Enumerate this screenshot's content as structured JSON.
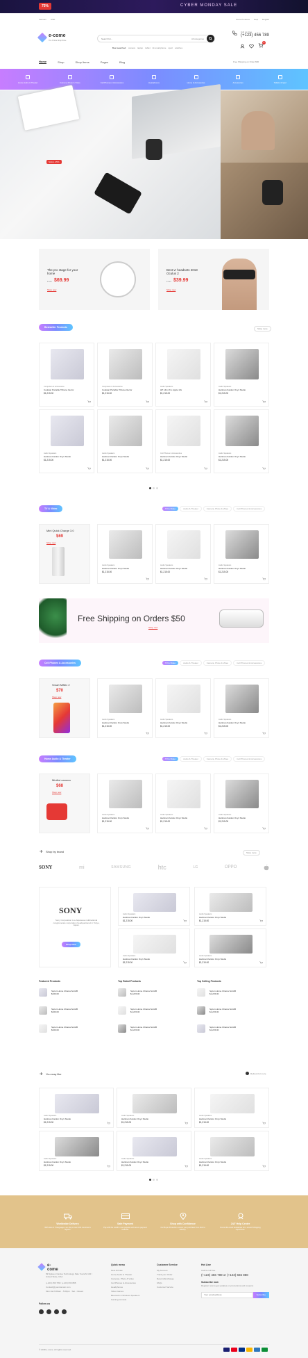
{
  "promo": {
    "badge": "75%",
    "text": "CYBER MONDAY SALE"
  },
  "topbar": {
    "left1": "Vietnam",
    "left2": "USD",
    "right1": "Store Products",
    "right2": "Help",
    "right3": "English"
  },
  "header": {
    "logo": "e-come",
    "tagline": "The Online Shop Store",
    "search_placeholder": "Search for...",
    "category": "All categories",
    "tags": [
      "Best searched:",
      "camera",
      "laptop",
      "tablet",
      "4k smartphone",
      "sport",
      "watches"
    ],
    "call_label": "Call us Free",
    "phone": "(+123) 456 789",
    "cart_count": "0"
  },
  "nav": {
    "items": [
      "Home",
      "Shop",
      "Shop Items",
      "Pages",
      "Blog"
    ],
    "shipping": "Free Shipping on Order $50"
  },
  "categories": [
    "Home Audio & Theater",
    "Camera, Photo & Video",
    "Cell Phones & Accessories",
    "Headphones",
    "Home & Accessories",
    "Accessories",
    "Tablets & Ipad"
  ],
  "hero": {
    "badge": "SALE -25%"
  },
  "promo_cards": [
    {
      "title": "The pro stage for your home",
      "price_label": "From",
      "price": "$69.99",
      "btn": "Shop now"
    },
    {
      "title": "Best vr headsets 2018 Oculus 2",
      "price_label": "From",
      "price": "$39.99",
      "btn": "Shop now"
    }
  ],
  "bestseller": {
    "tab": "Bestseller Products",
    "dropdown": "Shop more",
    "products": [
      {
        "cat": "Computers & Accessories",
        "name": "Coolstar Portable Tribuna Vector",
        "price": "$1,215.00"
      },
      {
        "cat": "Computers & Accessories",
        "name": "Coolstar Portable Tribuna Vector",
        "price": "$1,215.00"
      },
      {
        "cat": "Audio Speakers",
        "name": "HP 14in 16 x Apple 13x",
        "price": "$1,215.00"
      },
      {
        "cat": "Audio Speakers",
        "name": "Hartman Kardon Onyx Studio",
        "price": "$1,215.00"
      },
      {
        "cat": "Audio Speakers",
        "name": "Hartman Kardon Onyx Studio",
        "price": "$1,215.00"
      },
      {
        "cat": "Audio Speakers",
        "name": "Hartman Kardon Onyx Studio",
        "price": "$1,215.00"
      },
      {
        "cat": "Cell Phones & Accessories",
        "name": "Hartman Kardon Onyx Studio",
        "price": "$1,215.00"
      },
      {
        "cat": "Audio Speakers",
        "name": "Hartman Kardon Onyx Studio",
        "price": "$1,215.00"
      }
    ]
  },
  "section_tv": {
    "tab": "TV & Video",
    "filters": [
      "TV & Video",
      "Audio & Theater",
      "Camera, Photo & Video",
      "Cell Phones & Accessories"
    ],
    "feature": {
      "title": "Mini Quick Charge 3.0",
      "price": "$69",
      "btn": "Shop now"
    },
    "products": [
      {
        "cat": "Audio Speakers",
        "name": "Hartman Kardon Onyx Studio",
        "price": "$1,215.00"
      },
      {
        "cat": "Audio Speakers",
        "name": "Hartman Kardon Onyx Studio",
        "price": "$1,215.00"
      },
      {
        "cat": "Audio Speakers",
        "name": "Hartman Kardon Onyx Studio",
        "price": "$1,215.00"
      }
    ]
  },
  "banner": {
    "title": "Free Shipping on Orders $50",
    "btn": "Shop now"
  },
  "section_cell": {
    "tab": "Cell Phones & Accessories",
    "filters": [
      "TV & Video",
      "Audio & Theater",
      "Camera, Photo & Video",
      "Cell Phones & Accessories"
    ],
    "feature": {
      "title": "Smart MiMix 2",
      "price": "$70",
      "btn": "Shop now"
    },
    "products": [
      {
        "cat": "Audio Speakers",
        "name": "Hartman Kardon Onyx Studio",
        "price": "$1,215.00"
      },
      {
        "cat": "Audio Speakers",
        "name": "Hartman Kardon Onyx Studio",
        "price": "$1,215.00"
      },
      {
        "cat": "Audio Speakers",
        "name": "Hartman Kardon Onyx Studio",
        "price": "$1,215.00"
      }
    ]
  },
  "section_home": {
    "tab": "Home Audio & Theater",
    "filters": [
      "TV & Video",
      "Audio & Theater",
      "Camera, Photo & Video",
      "Cell Phones & Accessories"
    ],
    "feature": {
      "title": "Minilist camera",
      "price": "$68",
      "btn": "Shop now"
    },
    "products": [
      {
        "cat": "Audio Speakers",
        "name": "Hartman Kardon Onyx Studio",
        "price": "$1,215.00"
      },
      {
        "cat": "Audio Speakers",
        "name": "Hartman Kardon Onyx Studio",
        "price": "$1,215.00"
      },
      {
        "cat": "Audio Speakers",
        "name": "Hartman Kardon Onyx Studio",
        "price": "$1,215.00"
      }
    ]
  },
  "brands": {
    "title": "Shop by brand",
    "dropdown": "Shop more",
    "list": [
      "SONY",
      "mi",
      "SAMSUNG",
      "htc",
      "LG",
      "OPPO",
      ""
    ],
    "feature": {
      "logo": "SONY",
      "text": "Sony Corporation is a Japanese multinational conglomerate corporation headquartered in Tokyo, Japan.",
      "btn": "Shop Now"
    },
    "products": [
      {
        "cat": "Audio Speakers",
        "name": "Hartman Kardon Onyx Studio",
        "price": "$1,215.00"
      },
      {
        "cat": "Audio Speakers",
        "name": "Hartman Kardon Onyx Studio",
        "price": "$1,215.00"
      },
      {
        "cat": "Audio Speakers",
        "name": "Hartman Kardon Onyx Studio",
        "price": "$1,215.00"
      },
      {
        "cat": "Audio Speakers",
        "name": "Hartman Kardon Onyx Studio",
        "price": "$1,215.00"
      }
    ]
  },
  "lists": [
    {
      "title": "Featured Products",
      "items": [
        {
          "name": "Spcon Home Ulrama SmtAB",
          "price": "$160.00"
        },
        {
          "name": "Spcon Home Ulrama SmtAB",
          "price": "$160.00"
        },
        {
          "name": "Spcon Home Ulrama SmtAB",
          "price": "$160.00"
        }
      ]
    },
    {
      "title": "Top Rated Products",
      "items": [
        {
          "name": "Spcon Home Ulrama SmtAB",
          "price": "$1,215.00"
        },
        {
          "name": "Spcon Home Ulrama SmtAB",
          "price": "$1,215.00"
        },
        {
          "name": "Spcon Home Ulrama SmtAB",
          "price": "$1,215.00"
        }
      ]
    },
    {
      "title": "Top Selling Products",
      "items": [
        {
          "name": "Spcon Home Ulrama SmtAB",
          "price": "$1,215.00"
        },
        {
          "name": "Spcon Home Ulrama SmtAB",
          "price": "$1,215.00"
        },
        {
          "name": "Spcon Home Ulrama SmtAB",
          "price": "$1,215.00"
        }
      ]
    }
  ],
  "youmay": {
    "title": "You may like",
    "refresh": "Refresh for more",
    "products": [
      {
        "cat": "Audio Speakers",
        "name": "Hartman Kardon Onyx Studio",
        "price": "$1,215.00"
      },
      {
        "cat": "Audio Speakers",
        "name": "Hartman Kardon Onyx Studio",
        "price": "$1,215.00"
      },
      {
        "cat": "Audio Speakers",
        "name": "Hartman Kardon Onyx Studio",
        "price": "$1,215.00"
      },
      {
        "cat": "Audio Speakers",
        "name": "Hartman Kardon Onyx Studio",
        "price": "$1,215.00"
      },
      {
        "cat": "Audio Speakers",
        "name": "Hartman Kardon Onyx Studio",
        "price": "$1,215.00"
      },
      {
        "cat": "Audio Speakers",
        "name": "Hartman Kardon Onyx Studio",
        "price": "$1,215.00"
      }
    ]
  },
  "services": [
    {
      "title": "Worldwide Delivery",
      "text": "With sites in 5 languages, we ship to over 200 countries & regions."
    },
    {
      "title": "Safe Payment",
      "text": "Pay with the world's most popular and secure payment methods."
    },
    {
      "title": "Shop with Confidence",
      "text": "Our Buyer Protection covers your purchase from click to delivery."
    },
    {
      "title": "24/7 Help Center",
      "text": "Round-the-clock assistance for a smooth shopping experience."
    }
  ],
  "footer": {
    "logo": "e-come",
    "address": "69 Ngkeen Cantue Technology Sale Yuanchi 102 / United State, USA",
    "phone": "(+123) 456 789 / (+123) 666 888",
    "email": "Contact@yourdomain.com",
    "hours": "Mon-Sat 9:00am - 5:00pm · Sat - Closed",
    "follow": "Follow us",
    "col1": {
      "title": "Quick menu",
      "items": [
        "New Arrivals",
        "Home Audio & Theater",
        "Cameras, Photo & Video",
        "Cell Phones & Accessories",
        "Headphones",
        "Video Games",
        "Bluetooth & Wireless Speakers",
        "Gaming Console"
      ]
    },
    "col2": {
      "title": "Customer Service",
      "items": [
        "My Account",
        "Track your Order",
        "Returns/Exchange",
        "FAQs",
        "Customer Service"
      ]
    },
    "col3": {
      "title": "Hot Line",
      "call": "Call Us toll free",
      "phone": "(+123) 456 789 or (+123) 666 888",
      "news": "Subscribe now",
      "news_text": "Register now to get updates on promotions and coupons",
      "placeholder": "Your email address",
      "btn": "Subscribe"
    },
    "copyright": "© 2018 e-come. All rights reserved."
  }
}
